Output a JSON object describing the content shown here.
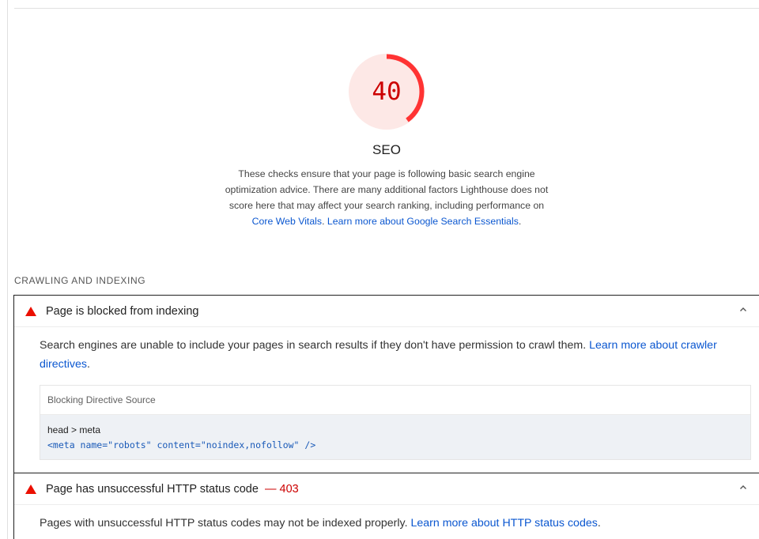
{
  "gauge": {
    "score": "40",
    "score_fraction": 0.4,
    "color": "#ff3333",
    "fill_color": "#fde8e6"
  },
  "category": {
    "title": "SEO",
    "description_text": "These checks ensure that your page is following basic search engine optimization advice. There are many additional factors Lighthouse does not score here that may affect your search ranking, including performance on",
    "link1": "Core Web Vitals",
    "link2": "Learn more about Google Search Essentials"
  },
  "group": {
    "title": "CRAWLING AND INDEXING"
  },
  "audits": [
    {
      "title": "Page is blocked from indexing",
      "description": "Search engines are unable to include your pages in search results if they don't have permission to crawl them.",
      "link": "Learn more about crawler directives",
      "table": {
        "header": "Blocking Directive Source",
        "node_path": "head > meta",
        "snippet": "<meta name=\"robots\" content=\"noindex,nofollow\" />"
      }
    },
    {
      "title": "Page has unsuccessful HTTP status code",
      "display_value": "— 403",
      "description": "Pages with unsuccessful HTTP status codes may not be indexed properly.",
      "link": "Learn more about HTTP status codes"
    }
  ]
}
